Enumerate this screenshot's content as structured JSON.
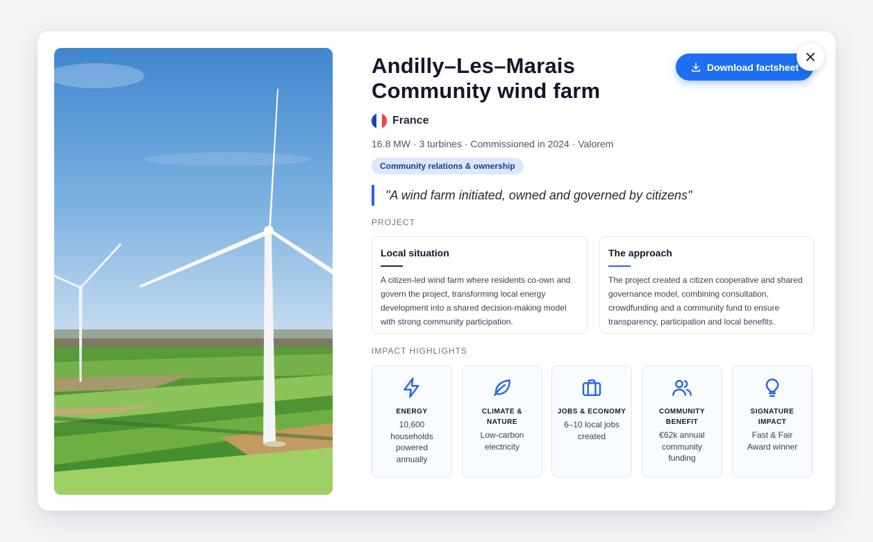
{
  "header": {
    "title_line1": "Andilly–Les–Marais",
    "title_line2": "Community wind farm",
    "country": "France",
    "meta": "16.8 MW · 3 turbines · Commissioned in 2024 · Valorem",
    "tag": "Community relations & ownership",
    "quote": "\"A wind farm initiated, owned and governed by citizens\""
  },
  "actions": {
    "download_label": "Download factsheet",
    "download_icon": "download-icon",
    "close_icon": "close-icon"
  },
  "project": {
    "section_label": "PROJECT",
    "cards": [
      {
        "title": "Local situation",
        "text": "A citizen-led wind farm where residents co-own and govern the project, transforming local energy development into a shared decision-making model with strong community participation.",
        "accent": "#1f2937"
      },
      {
        "title": "The approach",
        "text": "The project created a citizen cooperative and shared governance model, combining consultation, crowdfunding and a community fund to ensure transparency, participation and local benefits.",
        "accent": "#2563eb"
      }
    ]
  },
  "impact": {
    "section_label": "IMPACT HIGHLIGHTS",
    "tiles": [
      {
        "icon": "lightning-icon",
        "title": "ENERGY",
        "text": "10,600 households powered annually"
      },
      {
        "icon": "leaf-icon",
        "title": "CLIMATE & NATURE",
        "text": "Low-carbon electricity"
      },
      {
        "icon": "briefcase-icon",
        "title": "JOBS & ECONOMY",
        "text": "6–10 local jobs created"
      },
      {
        "icon": "users-icon",
        "title": "COMMUNITY BENEFIT",
        "text": "€62k annual community funding"
      },
      {
        "icon": "lightbulb-icon",
        "title": "SIGNATURE IMPACT",
        "text": "Fast & Fair Award winner"
      }
    ]
  },
  "colors": {
    "accent": "#1f6ff2",
    "tag_bg": "#dbe8fd",
    "quote_bar": "#2563eb",
    "flag": [
      "#1e40af",
      "#ffffff",
      "#ef4444"
    ]
  }
}
